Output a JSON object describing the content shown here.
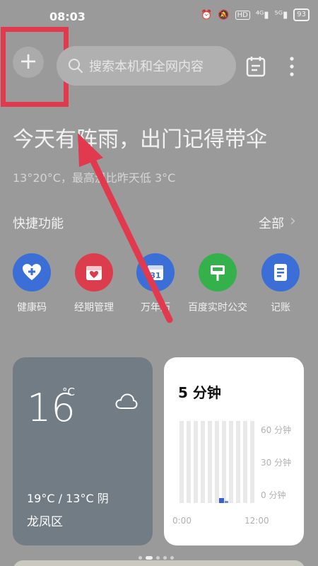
{
  "status_bar": {
    "time": "08:03",
    "icons": [
      "alarm-icon",
      "mute-icon",
      "hd-icon",
      "signal-4g-icon",
      "signal-5g-icon"
    ],
    "icon_glyphs": [
      "⏰",
      "🔕",
      "HD",
      "⁴ᴳ▮",
      "⁵ᴳ▮"
    ],
    "battery": "93"
  },
  "header": {
    "add_label": "+",
    "search_placeholder": "搜索本机和全网内容",
    "more_label": "⋮"
  },
  "headline": "今天有阵雨，出门记得带伞",
  "subline": "13°20°C，最高温比昨天低 3°C",
  "quick_section": {
    "title": "快捷功能",
    "more": "全部",
    "chevron": "›",
    "items": [
      {
        "label": "健康码",
        "color": "#3b6fd7",
        "icon": "heart-plus-icon"
      },
      {
        "label": "经期管理",
        "color": "#dc3d4d",
        "icon": "calendar-heart-icon"
      },
      {
        "label": "万年历",
        "color": "#3b6fd7",
        "icon": "calendar-31-icon",
        "badge": "31"
      },
      {
        "label": "百度实时公交",
        "color": "#34b14a",
        "icon": "bus-stop-icon"
      },
      {
        "label": "记账",
        "color": "#3b6fd7",
        "icon": "notebook-icon"
      }
    ]
  },
  "weather_card": {
    "temperature": "16",
    "unit": "°C",
    "condition_icon": "cloud-icon",
    "range": "19°C / 13°C  阴",
    "district": "龙凤区"
  },
  "screen_time_card": {
    "title": "5 分钟",
    "y_ticks": [
      "60 分钟",
      "30 分钟",
      "0 分钟"
    ],
    "x_ticks": [
      "0:00",
      "12:00"
    ]
  },
  "colors": {
    "background": "#9a9a9a",
    "highlight": "#e13a4e",
    "accent_blue": "#3b5fcf"
  }
}
